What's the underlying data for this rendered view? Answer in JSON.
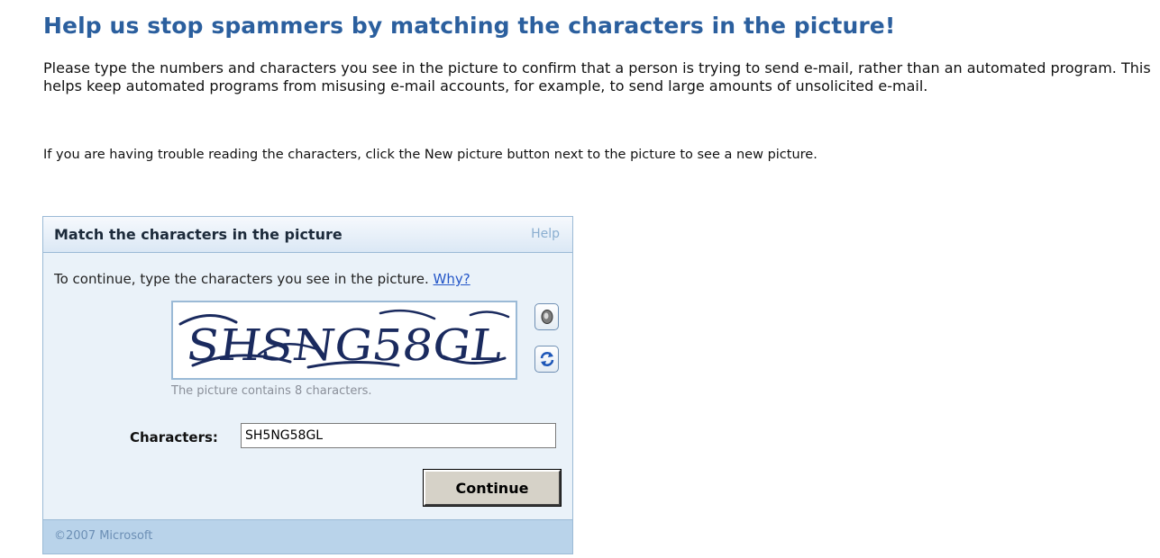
{
  "page": {
    "title": "Help us stop spammers by matching the characters in the picture!",
    "intro": "Please type the numbers and characters you see in the picture to confirm that a person is trying to send e-mail, rather than an automated program. This helps keep automated programs from misusing e-mail accounts, for example, to send large amounts of unsolicited e-mail.",
    "trouble": "If you are having trouble reading the characters, click the New picture button next to the picture to see a new picture."
  },
  "panel": {
    "title": "Match the characters in the picture",
    "help_label": "Help",
    "instruction": "To continue, type the characters you see in the picture.",
    "why_label": "Why?",
    "captcha_text": "SHSNG58GL",
    "char_count_text": "The picture contains 8 characters.",
    "characters_label": "Characters:",
    "characters_value": "SH5NG58GL",
    "continue_label": "Continue",
    "audio_icon": "speaker-icon",
    "refresh_icon": "refresh-icon",
    "footer": "©2007 Microsoft"
  },
  "colors": {
    "title": "#2b5f9e",
    "panel_bg": "#eaf2f9",
    "panel_border": "#9bbad6",
    "footer_bg": "#b9d3ea",
    "link": "#2456c8",
    "captcha_ink": "#1a2a5e"
  }
}
